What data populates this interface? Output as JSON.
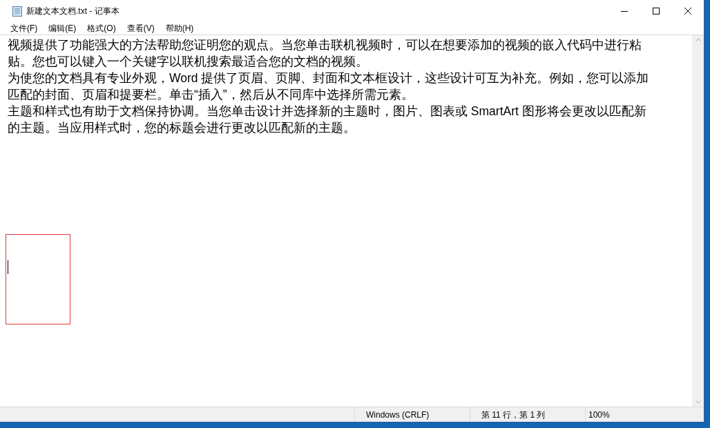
{
  "window": {
    "title": "新建文本文档.txt - 记事本"
  },
  "menu": [
    {
      "label": "文件(F)"
    },
    {
      "label": "编辑(E)"
    },
    {
      "label": "格式(O)"
    },
    {
      "label": "查看(V)"
    },
    {
      "label": "帮助(H)"
    }
  ],
  "editor": {
    "paragraphs": [
      {
        "lines": [
          "视频提供了功能强大的方法帮助您证明您的观点。当您单击联机视频时，可以在想要添加的视频的嵌入代码中进行粘",
          "贴。您也可以键入一个关键字以联机搜索最适合您的文档的视频。"
        ]
      },
      {
        "lines": [
          "为使您的文档具有专业外观，Word 提供了页眉、页脚、封面和文本框设计，这些设计可互为补充。例如，您可以添加",
          "匹配的封面、页眉和提要栏。单击“插入”，然后从不同库中选择所需元素。"
        ]
      },
      {
        "lines": [
          "主题和样式也有助于文档保持协调。当您单击设计并选择新的主题时，图片、图表或 SmartArt 图形将会更改以匹配新",
          "的主题。当应用样式时，您的标题会进行更改以匹配新的主题。"
        ]
      }
    ]
  },
  "status_bar": {
    "line_ending": "Windows (CRLF)",
    "position": "第 11 行，第 1 列",
    "zoom": "100%"
  }
}
